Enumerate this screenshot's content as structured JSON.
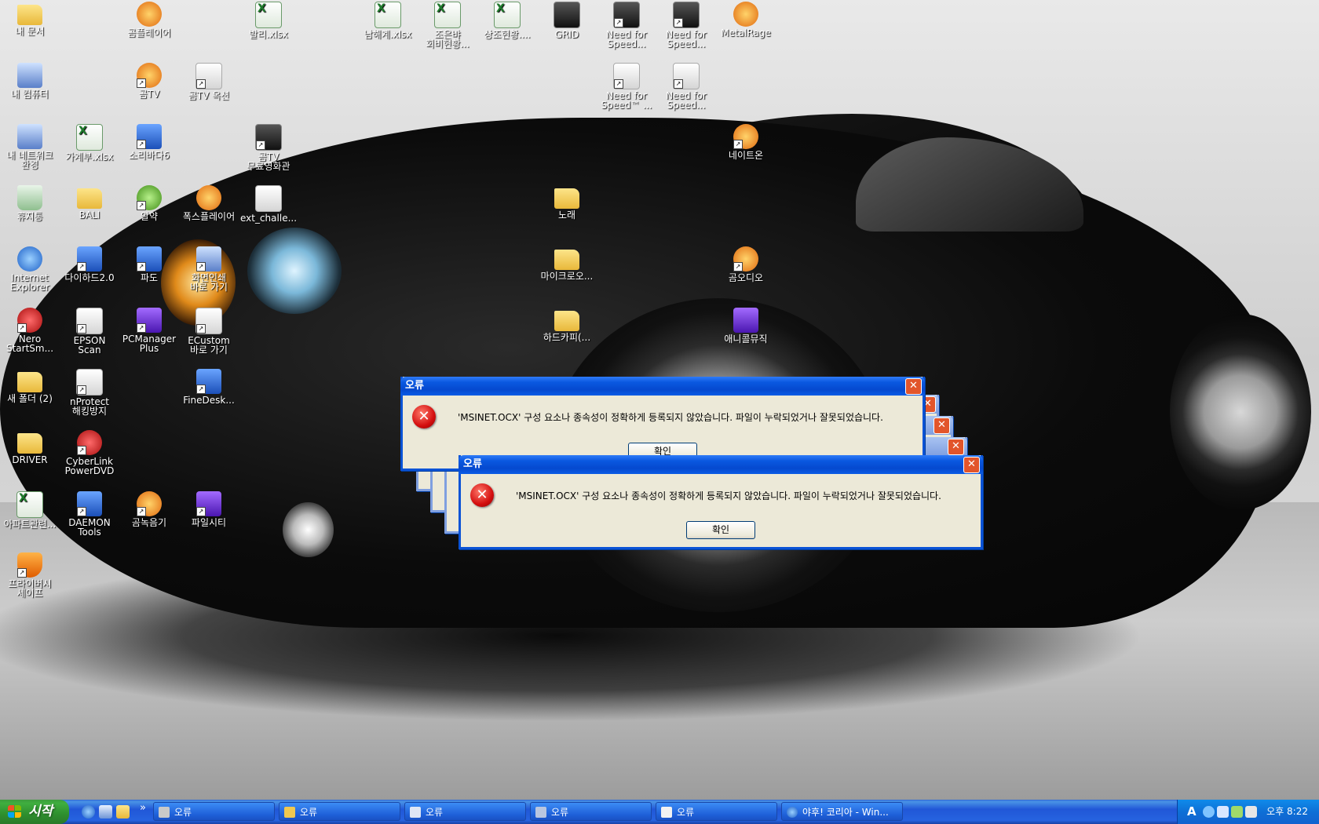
{
  "desktop": {
    "icons": [
      {
        "label": "내 문서",
        "line2": ""
      },
      {
        "label": "내 컴퓨터",
        "line2": ""
      },
      {
        "label": "내 네트워크",
        "line2": "환경"
      },
      {
        "label": "휴지통",
        "line2": ""
      },
      {
        "label": "Internet",
        "line2": "Explorer"
      },
      {
        "label": "Nero",
        "line2": "StartSm..."
      },
      {
        "label": "새 폴더 (2)",
        "line2": ""
      },
      {
        "label": "DRIVER",
        "line2": ""
      },
      {
        "label": "아파트관련...",
        "line2": ""
      },
      {
        "label": "프라이버시",
        "line2": "세이프"
      },
      {
        "label": "가계부.xlsx",
        "line2": ""
      },
      {
        "label": "BALI",
        "line2": ""
      },
      {
        "label": "다이하드2.0",
        "line2": ""
      },
      {
        "label": "EPSON",
        "line2": "Scan"
      },
      {
        "label": "nProtect",
        "line2": "해킹방지"
      },
      {
        "label": "CyberLink",
        "line2": "PowerDVD"
      },
      {
        "label": "DAEMON",
        "line2": "Tools"
      },
      {
        "label": "곰플레이어",
        "line2": ""
      },
      {
        "label": "곰TV",
        "line2": ""
      },
      {
        "label": "소리바다6",
        "line2": ""
      },
      {
        "label": "알약",
        "line2": ""
      },
      {
        "label": "파도",
        "line2": ""
      },
      {
        "label": "PCManager",
        "line2": "Plus"
      },
      {
        "label": "곰녹음기",
        "line2": ""
      },
      {
        "label": "곰TV 옥션",
        "line2": ""
      },
      {
        "label": "폭스플레이어",
        "line2": ""
      },
      {
        "label": "화면인쇄",
        "line2": "바로 가기"
      },
      {
        "label": "ECustom",
        "line2": "바로 가기"
      },
      {
        "label": "FineDesk...",
        "line2": ""
      },
      {
        "label": "파일시티",
        "line2": ""
      },
      {
        "label": "발리.xlsx",
        "line2": ""
      },
      {
        "label": "곰TV",
        "line2": "무료영화관"
      },
      {
        "label": "ext_challe...",
        "line2": ""
      },
      {
        "label": "남해계.xlsx",
        "line2": ""
      },
      {
        "label": "조은뱌",
        "line2": "회비현황..."
      },
      {
        "label": "상조현황....",
        "line2": ""
      },
      {
        "label": "GRID",
        "line2": ""
      },
      {
        "label": "Need for",
        "line2": "Speed..."
      },
      {
        "label": "Need for",
        "line2": "Speed..."
      },
      {
        "label": "MetalRage",
        "line2": ""
      },
      {
        "label": "Need for",
        "line2": "Speed™ ..."
      },
      {
        "label": "Need for",
        "line2": "Speed..."
      },
      {
        "label": "네이트온",
        "line2": ""
      },
      {
        "label": "노래",
        "line2": ""
      },
      {
        "label": "마이크로오...",
        "line2": ""
      },
      {
        "label": "하드카피(...",
        "line2": ""
      },
      {
        "label": "곰오디오",
        "line2": ""
      },
      {
        "label": "애니콜뮤직",
        "line2": ""
      }
    ]
  },
  "dialogs": [
    {
      "title": "오류",
      "message": "'MSINET.OCX' 구성 요소나 종속성이 정확하게 등록되지 않았습니다. 파일이 누락되었거나 잘못되었습니다.",
      "ok_label": "확인"
    },
    {
      "title": "오류",
      "message": "'MSINET.OCX' 구성 요소나 종속성이 정확하게 등록되지 않았습니다. 파일이 누락되었거나 잘못되었습니다.",
      "ok_label": "확인"
    }
  ],
  "taskbar": {
    "start_label": "시작",
    "chevron": "»",
    "buttons": [
      {
        "label": "오류",
        "icon": "tools-icon"
      },
      {
        "label": "오류",
        "icon": "folder-icon"
      },
      {
        "label": "오류",
        "icon": "grid-icon"
      },
      {
        "label": "오류",
        "icon": "settings-icon"
      },
      {
        "label": "오류",
        "icon": "document-icon"
      },
      {
        "label": "야후! 코리아 - Win...",
        "icon": "ie-icon"
      }
    ],
    "clock": "오후 8:22",
    "ime": "A"
  },
  "colors": {
    "title_active": "#0a58e0",
    "dialog_bg": "#ece9d8",
    "start_green": "#3fae3f",
    "taskbar_blue": "#2157d7",
    "error_red": "#d40f0f"
  }
}
